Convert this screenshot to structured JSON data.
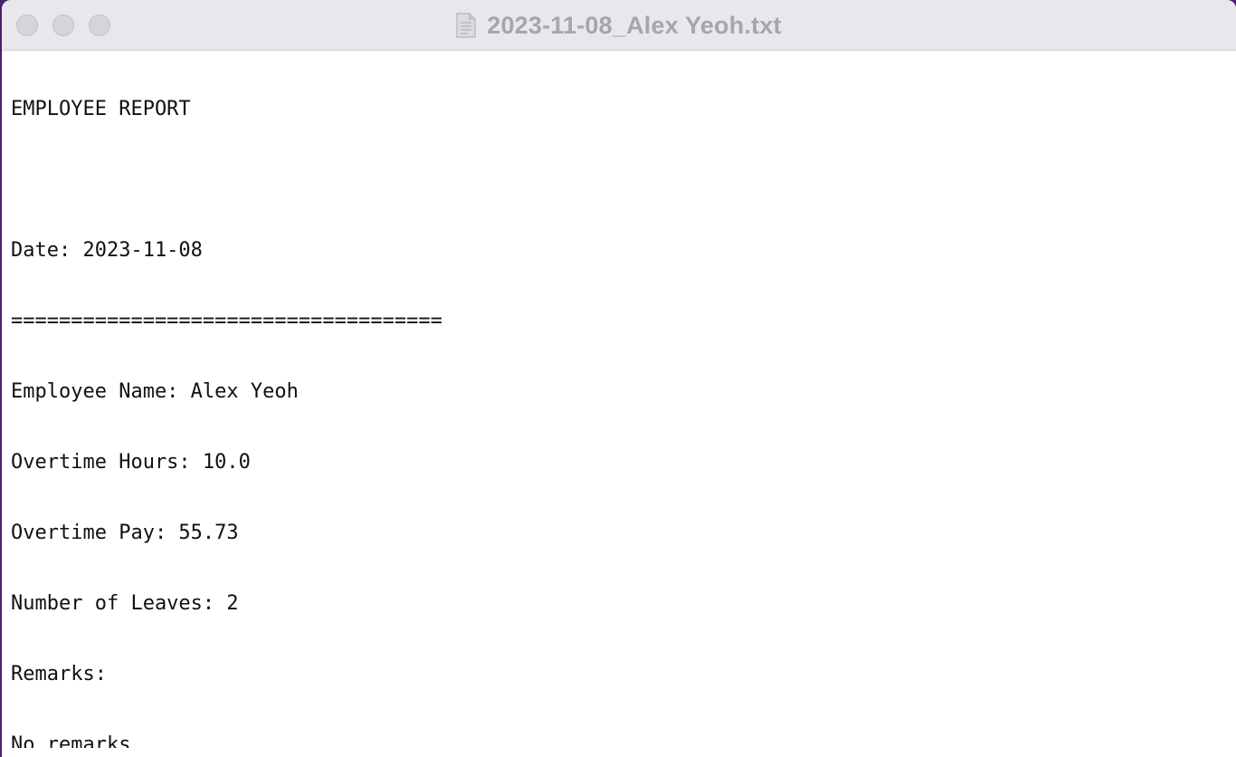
{
  "window": {
    "title": "2023-11-08_Alex Yeoh.txt",
    "title_icon": "document-icon"
  },
  "document": {
    "lines": [
      "EMPLOYEE REPORT",
      "",
      "Date: 2023-11-08",
      "====================================",
      "Employee Name: Alex Yeoh",
      "Overtime Hours: 10.0",
      "Overtime Pay: 55.73",
      "Number of Leaves: 2",
      "Remarks:",
      "No remarks"
    ]
  },
  "colors": {
    "titlebar": "#e9e7ec",
    "title_text": "#a7a5ab",
    "desktop": "#4a1f6e",
    "text": "#111111"
  }
}
